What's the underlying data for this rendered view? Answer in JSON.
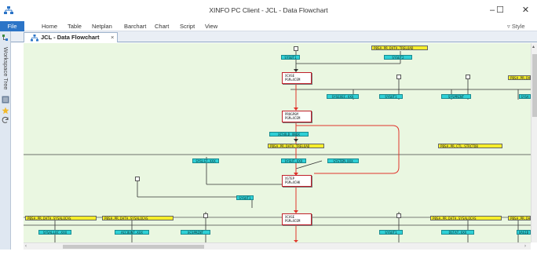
{
  "window": {
    "title": "XINFO PC Client - JCL - Data Flowchart",
    "minimize": "–",
    "maximize": "☐",
    "close": "✕"
  },
  "menu": {
    "items": [
      "File",
      "Home",
      "Table",
      "Netplan",
      "Barchart",
      "Chart",
      "Script",
      "View"
    ],
    "style": "▿ Style"
  },
  "dock": {
    "label": "Workspace Tree"
  },
  "tab": {
    "label": "JCL - Data Flowchart",
    "close": "×"
  },
  "colors": {
    "accent": "#2b74c7",
    "canvas": "#eaf7e1",
    "dataset": "#2fd0d6",
    "file": "#f6ee2a",
    "step_border": "#c0202a",
    "flow_line": "#e0342c"
  },
  "icons": [
    "app-flowchart-icon",
    "tree-icon",
    "list-icon",
    "star-icon",
    "refresh-icon",
    "tab-flowchart-icon"
  ],
  "flowchart": {
    "steps": [
      {
        "line1": "XCASE",
        "line2": "PGM=XCEM"
      },
      {
        "line1": "PROGPGM",
        "line2": "PGM=XCEM"
      },
      {
        "line1": "XSTEP",
        "line2": "PGM=XCHK"
      },
      {
        "line1": "XCASE",
        "line2": "PGM=XCEM"
      }
    ],
    "datasets": [
      "SYSUT1",
      "SYSUT2",
      "SYSEXEC.XXX",
      "SYSUT1",
      "SYSPRINT",
      "SYSA",
      "XCSOLD.XNDX",
      "SYSLST.XXX",
      "SYSUT.XXX",
      "SYSTEM.XXX",
      "SYSUT1",
      "SYSALLOC.XXX",
      "ACCOUNT.XXX",
      "XCSPRINT",
      "SYSUT1",
      "DSTAT.XXX",
      "XASID"
    ],
    "files": [
      "PBSA.PR.DATA.TRELOAD",
      "PBSA.PR.DATA",
      "PBSA.PR.DATA.TRELOAD",
      "PBSA.PR.CTL.STRCTDB",
      "PBSA.PR.DATA.SYSALOCAS",
      "PBSA.PR.DATA.SYSALOCAS",
      "PBSA.PR.DATA.SYSALOCAS",
      "PBSA.PR.DATA"
    ]
  }
}
